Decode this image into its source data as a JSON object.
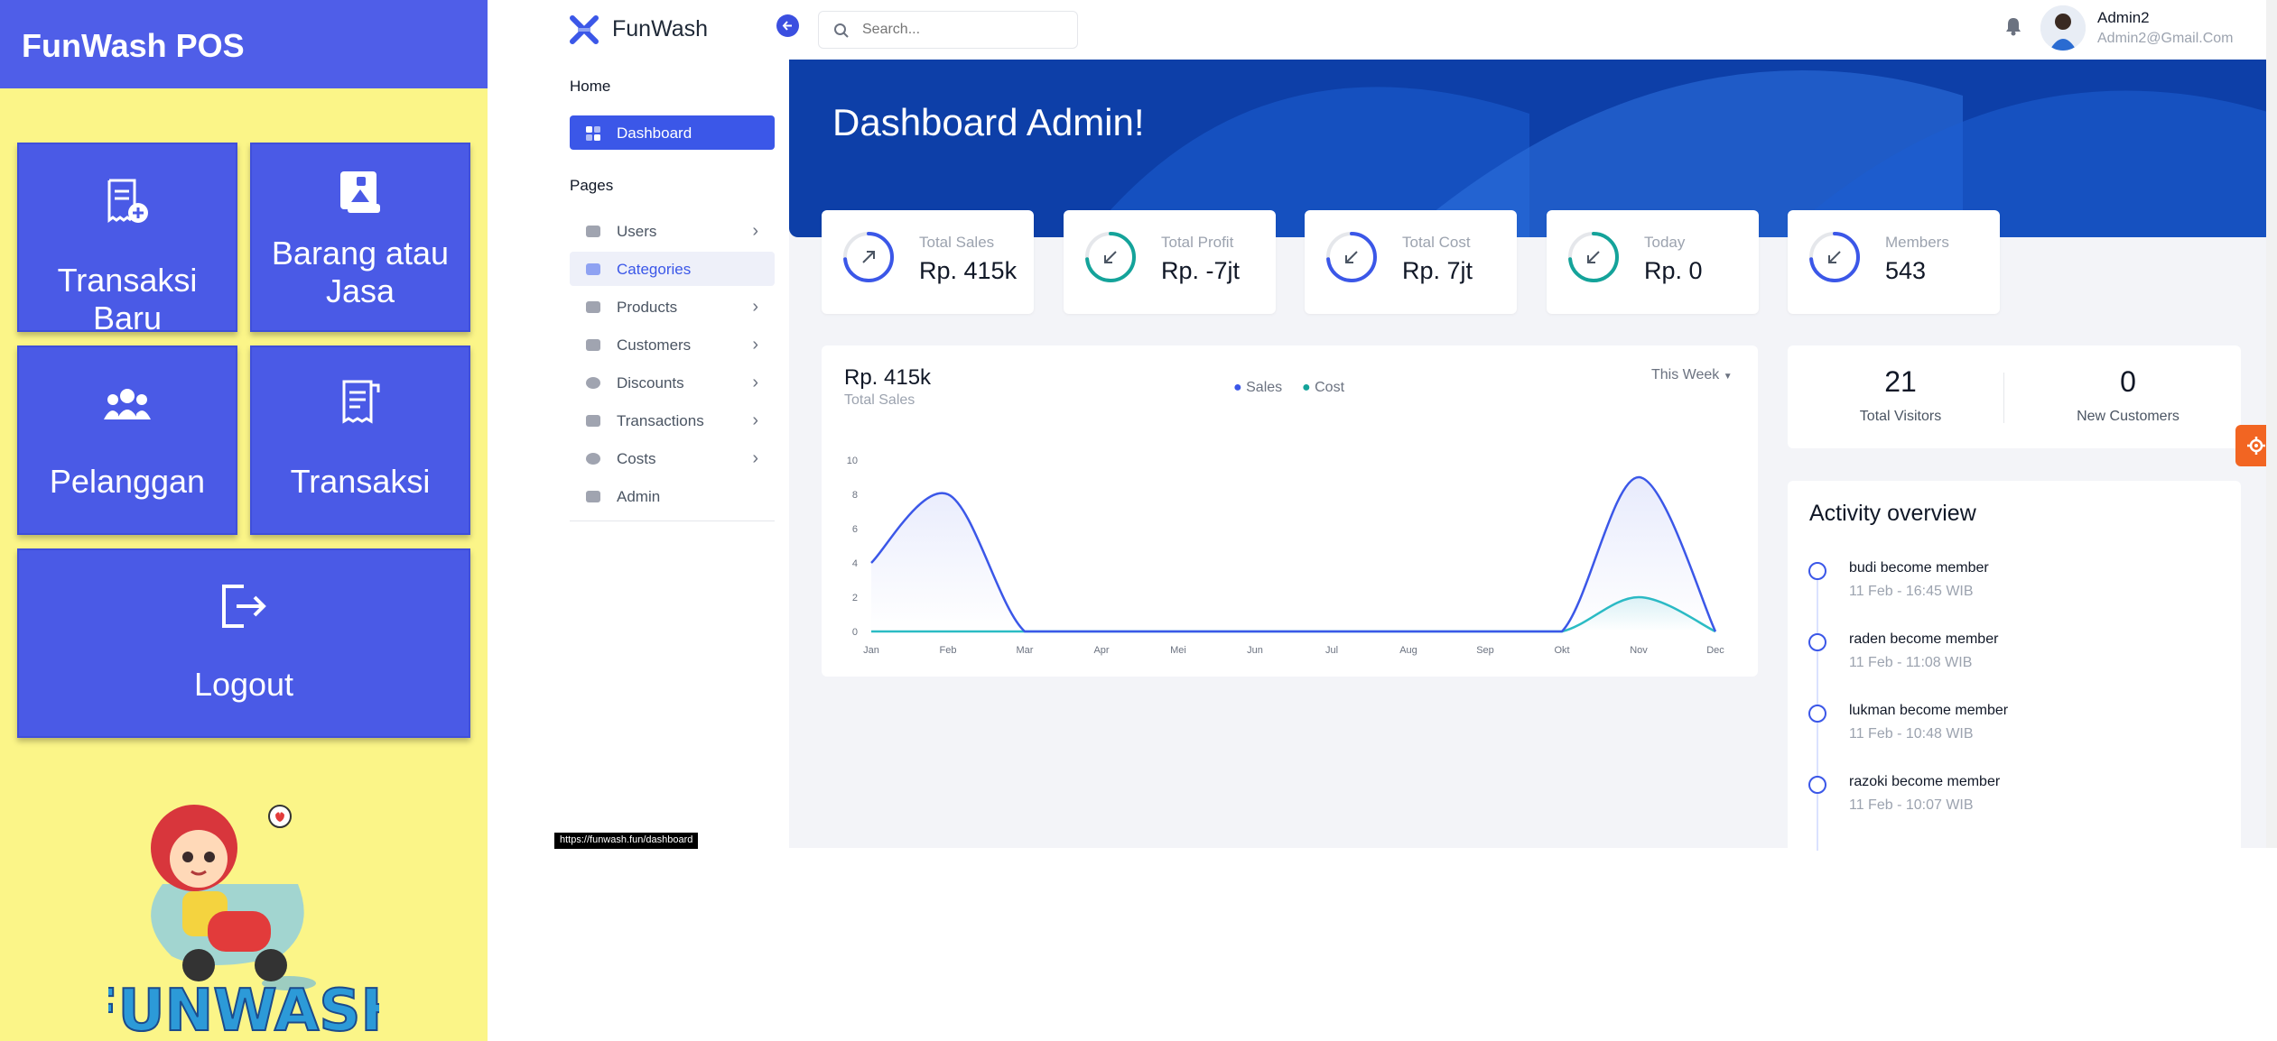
{
  "pos": {
    "title": "FunWash POS",
    "tiles": [
      {
        "label": "Transaksi Baru",
        "icon": "receipt-plus-icon"
      },
      {
        "label": "Barang atau Jasa",
        "icon": "goods-icon"
      },
      {
        "label": "Pelanggan",
        "icon": "users-icon"
      },
      {
        "label": "Transaksi",
        "icon": "receipt-icon"
      },
      {
        "label": "Logout",
        "icon": "logout-icon"
      }
    ],
    "mascot_logo_text": "FUNWASH"
  },
  "topbar": {
    "brand": "FunWash",
    "search_placeholder": "Search...",
    "user_name": "Admin2",
    "user_email": "Admin2@Gmail.Com"
  },
  "sidebar": {
    "home_heading": "Home",
    "dashboard_label": "Dashboard",
    "pages_heading": "Pages",
    "items": [
      {
        "label": "Users",
        "has_submenu": true
      },
      {
        "label": "Categories",
        "has_submenu": false,
        "active": true
      },
      {
        "label": "Products",
        "has_submenu": true
      },
      {
        "label": "Customers",
        "has_submenu": true
      },
      {
        "label": "Discounts",
        "has_submenu": true
      },
      {
        "label": "Transactions",
        "has_submenu": true
      },
      {
        "label": "Costs",
        "has_submenu": true
      },
      {
        "label": "Admin",
        "has_submenu": false
      }
    ],
    "link_preview": "https://funwash.fun/dashboard"
  },
  "dashboard": {
    "title": "Dashboard Admin!",
    "stats": [
      {
        "label": "Total Sales",
        "value": "Rp. 415k",
        "trend": "up",
        "color": "#3b57e8"
      },
      {
        "label": "Total Profit",
        "value": "Rp. -7jt",
        "trend": "down",
        "color": "#14a39a"
      },
      {
        "label": "Total Cost",
        "value": "Rp. 7jt",
        "trend": "down",
        "color": "#3b57e8"
      },
      {
        "label": "Today",
        "value": "Rp. 0",
        "trend": "down",
        "color": "#14a39a"
      },
      {
        "label": "Members",
        "value": "543",
        "trend": "down",
        "color": "#3b57e8"
      }
    ],
    "sales_chart": {
      "headline": "Rp. 415k",
      "subtitle": "Total Sales",
      "range": "This Week",
      "legend": {
        "sales": "Sales",
        "cost": "Cost"
      }
    },
    "visitors": {
      "value": "21",
      "label": "Total Visitors"
    },
    "new_customers": {
      "value": "0",
      "label": "New Customers"
    },
    "activity": {
      "title": "Activity overview",
      "items": [
        {
          "text": "budi become member",
          "time": "11 Feb - 16:45 WIB"
        },
        {
          "text": "raden become member",
          "time": "11 Feb - 11:08 WIB"
        },
        {
          "text": "lukman become member",
          "time": "11 Feb - 10:48 WIB"
        },
        {
          "text": "razoki become member",
          "time": "11 Feb - 10:07 WIB"
        }
      ]
    }
  },
  "colors": {
    "brand": "#3b57e8",
    "teal": "#14a39a",
    "pos_yellow": "#fbf588",
    "pos_blue": "#4a5ae6",
    "hero": "#0d3fa8",
    "accent_orange": "#f26522"
  },
  "chart_data": {
    "type": "area",
    "categories": [
      "Jan",
      "Feb",
      "Mar",
      "Apr",
      "Mei",
      "Jun",
      "Jul",
      "Aug",
      "Sep",
      "Okt",
      "Nov",
      "Dec"
    ],
    "ylim": [
      0,
      10
    ],
    "yticks": [
      0,
      2,
      4,
      6,
      8,
      10
    ],
    "series": [
      {
        "name": "Sales",
        "color": "#3b57e8",
        "values": [
          4,
          8,
          0,
          0,
          0,
          0,
          0,
          0,
          0,
          0,
          9,
          0
        ]
      },
      {
        "name": "Cost",
        "color": "#2bbcc4",
        "values": [
          0,
          0,
          0,
          0,
          0,
          0,
          0,
          0,
          0,
          0,
          2,
          0
        ]
      }
    ],
    "legend": "top-center",
    "grid": false
  }
}
